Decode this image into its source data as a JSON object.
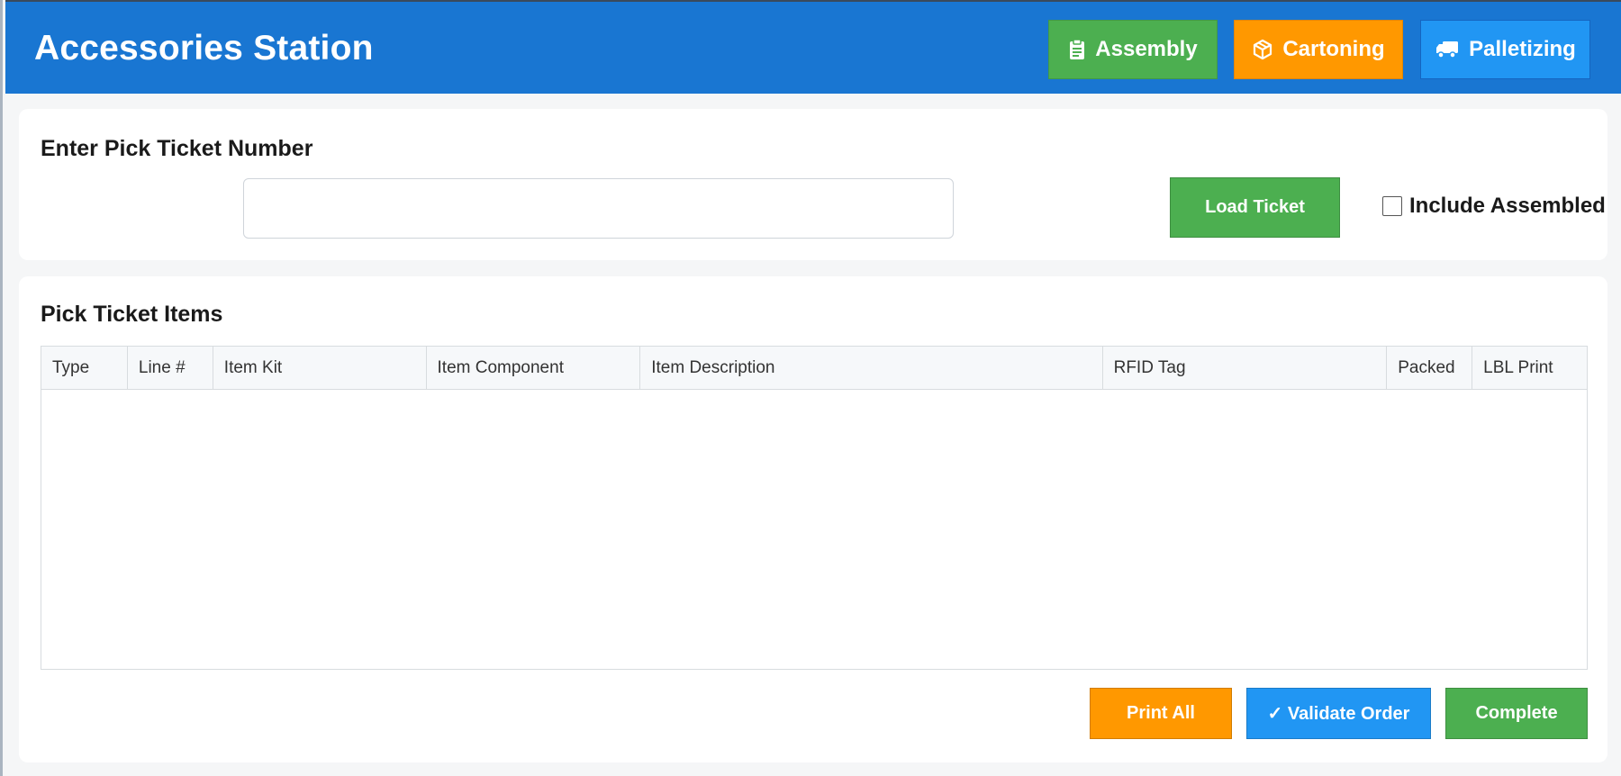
{
  "header": {
    "title": "Accessories Station",
    "nav": [
      {
        "label": "Assembly",
        "icon": "clipboard-icon",
        "color": "#4caf50"
      },
      {
        "label": "Cartoning",
        "icon": "box-icon",
        "color": "#ff9800"
      },
      {
        "label": "Palletizing",
        "icon": "truck-icon",
        "color": "#2196f3"
      }
    ],
    "background": "#1976d2"
  },
  "ticket": {
    "title": "Enter Pick Ticket Number",
    "input_value": "",
    "load_label": "Load Ticket",
    "include_assembled_label": "Include Assembled",
    "include_assembled_checked": false
  },
  "items": {
    "title": "Pick Ticket Items",
    "columns": [
      "Type",
      "Line #",
      "Item Kit",
      "Item Component",
      "Item Description",
      "RFID Tag",
      "Packed",
      "LBL Print"
    ],
    "rows": []
  },
  "actions": {
    "print_all_label": "Print All",
    "validate_label": "✓ Validate Order",
    "complete_label": "Complete"
  }
}
